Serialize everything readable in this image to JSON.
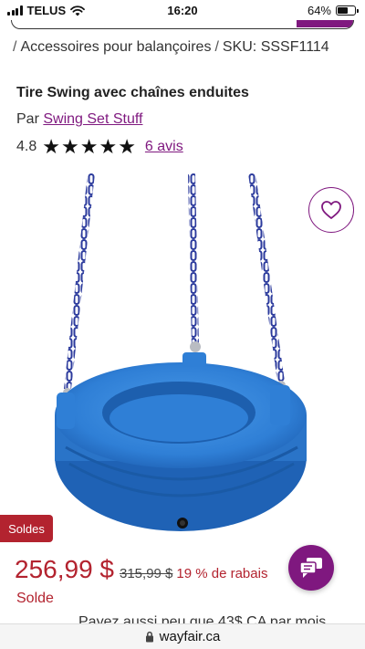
{
  "status_bar": {
    "carrier": "TELUS",
    "time": "16:20",
    "battery_percent": "64%",
    "battery_level": 0.64,
    "icons": [
      "signal-icon",
      "wifi-icon",
      "battery-icon"
    ]
  },
  "breadcrumb": {
    "separator": "/",
    "category": "Accessoires pour balançoires",
    "sku": "SKU: SSSF1114"
  },
  "product": {
    "title": "Tire Swing avec chaînes enduites",
    "by_prefix": "Par",
    "brand": "Swing Set Stuff",
    "rating": "4.8",
    "stars_filled": 5,
    "reviews_link": "6 avis"
  },
  "image": {
    "subject": "blue tire swing with blue coated chains",
    "colors": {
      "tire": "#2f7fd6",
      "chain": "#2b3a9c"
    }
  },
  "actions": {
    "favorite_icon": "heart-icon",
    "chat_icon": "chat-icon"
  },
  "pricing": {
    "badge": "Soldes",
    "price": "256,99 $",
    "original_price": "315,99 $",
    "discount": "19 % de rabais",
    "label": "Solde",
    "installment_text": "Payez aussi peu que 43$ CA par mois"
  },
  "url_bar": {
    "domain": "wayfair.ca",
    "icon": "lock-icon"
  },
  "colors": {
    "brand_purple": "#7f187f",
    "sale_red": "#b3232f"
  }
}
